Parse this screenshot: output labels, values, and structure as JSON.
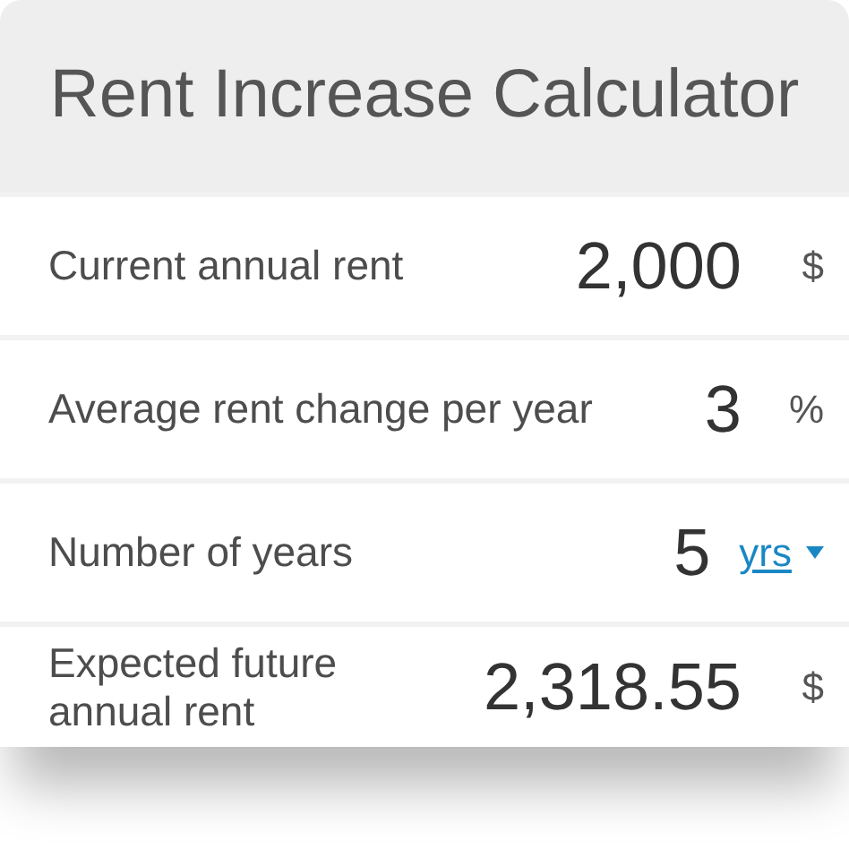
{
  "title": "Rent Increase Calculator",
  "rows": [
    {
      "kind": "input",
      "label": "Current annual rent",
      "value": "2,000",
      "unit": "$"
    },
    {
      "kind": "input",
      "label": "Average rent change per year",
      "value": "3",
      "unit": "%"
    },
    {
      "kind": "select",
      "label": "Number of years",
      "value": "5",
      "unit": "yrs"
    },
    {
      "kind": "result",
      "label": "Expected future annual rent",
      "value": "2,318.55",
      "unit": "$"
    }
  ]
}
